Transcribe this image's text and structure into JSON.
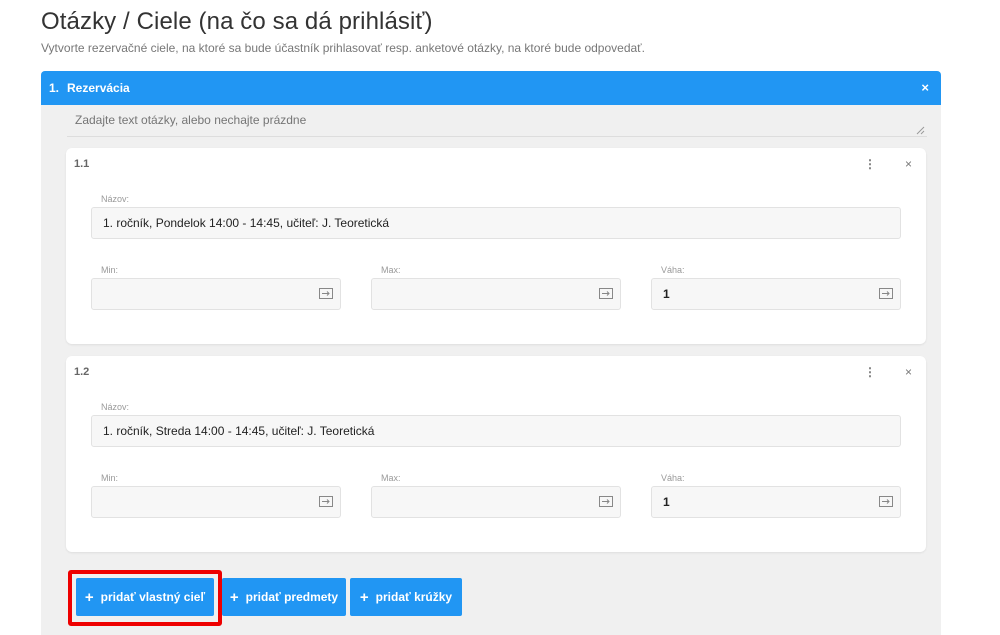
{
  "page": {
    "title": "Otázky / Ciele (na čo sa dá prihlásiť)",
    "subtitle": "Vytvorte rezervačné ciele, na ktoré sa bude účastník prihlasovať resp. anketové otázky, na ktoré bude odpovedať."
  },
  "question": {
    "number": "1.",
    "title": "Rezervácia",
    "close_icon": "×",
    "text_placeholder": "Zadajte text otázky, alebo nechajte prázdne"
  },
  "goals": [
    {
      "id": "1.1",
      "name_label": "Názov:",
      "name_value": "1. ročník, Pondelok 14:00 - 14:45, učiteľ: J. Teoretická",
      "min_label": "Min:",
      "min_value": "",
      "max_label": "Max:",
      "max_value": "",
      "weight_label": "Váha:",
      "weight_value": "1",
      "menu_icon": "⋮",
      "close_icon": "×"
    },
    {
      "id": "1.2",
      "name_label": "Názov:",
      "name_value": "1. ročník, Streda 14:00 - 14:45, učiteľ: J. Teoretická",
      "min_label": "Min:",
      "min_value": "",
      "max_label": "Max:",
      "max_value": "",
      "weight_label": "Váha:",
      "weight_value": "1",
      "menu_icon": "⋮",
      "close_icon": "×"
    }
  ],
  "buttons": {
    "plus_icon": "+",
    "add_custom_goal": "pridať vlastný cieľ",
    "add_subjects": "pridať predmety",
    "add_clubs": "pridať krúžky"
  },
  "colors": {
    "accent": "#2196f3",
    "highlight": "#ee0000"
  },
  "icons": {
    "field_action": "enter-arrow-icon"
  }
}
